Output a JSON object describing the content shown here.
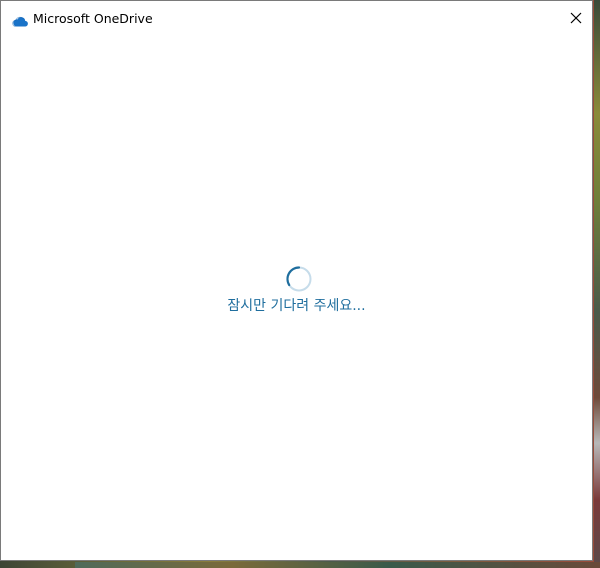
{
  "window": {
    "title": "Microsoft OneDrive",
    "app_icon": "onedrive-cloud-icon",
    "close_icon": "close-icon"
  },
  "content": {
    "loading_text": "잠시만 기다려 주세요...",
    "spinner_icon": "loading-spinner-icon"
  },
  "colors": {
    "accent": "#1f6e9e",
    "cloud": "#1a73c8"
  }
}
